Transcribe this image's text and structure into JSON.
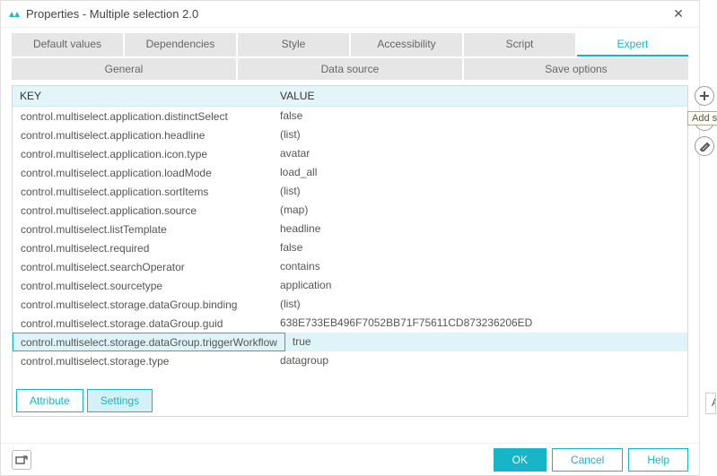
{
  "window": {
    "title": "Properties - Multiple selection 2.0"
  },
  "tabs_top": {
    "default_values": "Default values",
    "dependencies": "Dependencies",
    "style": "Style",
    "accessibility": "Accessibility",
    "script": "Script",
    "expert": "Expert"
  },
  "tabs_sub": {
    "general": "General",
    "data_source": "Data source",
    "save_options": "Save options"
  },
  "columns": {
    "key": "KEY",
    "value": "VALUE"
  },
  "rows": [
    {
      "k": "control.multiselect.application.distinctSelect",
      "v": "false"
    },
    {
      "k": "control.multiselect.application.headline",
      "v": "(list)"
    },
    {
      "k": "control.multiselect.application.icon.type",
      "v": "avatar"
    },
    {
      "k": "control.multiselect.application.loadMode",
      "v": "load_all"
    },
    {
      "k": "control.multiselect.application.sortItems",
      "v": "(list)"
    },
    {
      "k": "control.multiselect.application.source",
      "v": "(map)"
    },
    {
      "k": "control.multiselect.listTemplate",
      "v": "headline"
    },
    {
      "k": "control.multiselect.required",
      "v": "false"
    },
    {
      "k": "control.multiselect.searchOperator",
      "v": "contains"
    },
    {
      "k": "control.multiselect.sourcetype",
      "v": "application"
    },
    {
      "k": "control.multiselect.storage.dataGroup.binding",
      "v": "(list)"
    },
    {
      "k": "control.multiselect.storage.dataGroup.guid",
      "v": "638E733EB496F7052BB71F75611CD873236206ED"
    },
    {
      "k": "control.multiselect.storage.dataGroup.triggerWorkflow",
      "v": "true",
      "selected": true
    },
    {
      "k": "control.multiselect.storage.type",
      "v": "datagroup"
    }
  ],
  "side": {
    "add_tooltip": "Add setting"
  },
  "seg": {
    "attribute": "Attribute",
    "settings": "Settings"
  },
  "footer": {
    "ok": "OK",
    "cancel": "Cancel",
    "help": "Help"
  },
  "ghost_label": "Attr"
}
